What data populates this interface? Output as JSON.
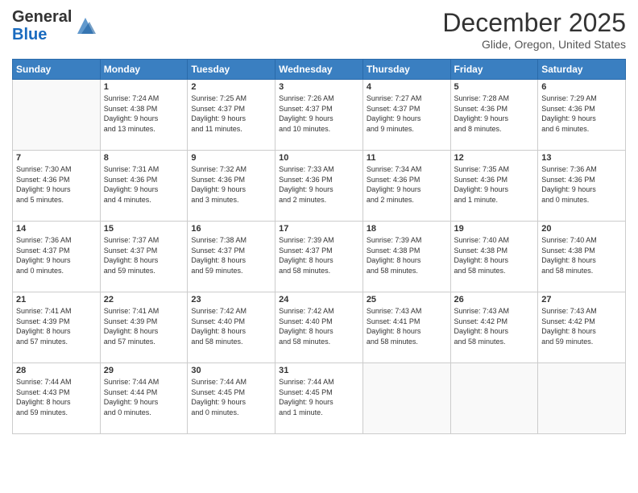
{
  "header": {
    "logo_general": "General",
    "logo_blue": "Blue",
    "month_title": "December 2025",
    "location": "Glide, Oregon, United States"
  },
  "days_of_week": [
    "Sunday",
    "Monday",
    "Tuesday",
    "Wednesday",
    "Thursday",
    "Friday",
    "Saturday"
  ],
  "weeks": [
    [
      {
        "day": "",
        "info": ""
      },
      {
        "day": "1",
        "info": "Sunrise: 7:24 AM\nSunset: 4:38 PM\nDaylight: 9 hours\nand 13 minutes."
      },
      {
        "day": "2",
        "info": "Sunrise: 7:25 AM\nSunset: 4:37 PM\nDaylight: 9 hours\nand 11 minutes."
      },
      {
        "day": "3",
        "info": "Sunrise: 7:26 AM\nSunset: 4:37 PM\nDaylight: 9 hours\nand 10 minutes."
      },
      {
        "day": "4",
        "info": "Sunrise: 7:27 AM\nSunset: 4:37 PM\nDaylight: 9 hours\nand 9 minutes."
      },
      {
        "day": "5",
        "info": "Sunrise: 7:28 AM\nSunset: 4:36 PM\nDaylight: 9 hours\nand 8 minutes."
      },
      {
        "day": "6",
        "info": "Sunrise: 7:29 AM\nSunset: 4:36 PM\nDaylight: 9 hours\nand 6 minutes."
      }
    ],
    [
      {
        "day": "7",
        "info": "Sunrise: 7:30 AM\nSunset: 4:36 PM\nDaylight: 9 hours\nand 5 minutes."
      },
      {
        "day": "8",
        "info": "Sunrise: 7:31 AM\nSunset: 4:36 PM\nDaylight: 9 hours\nand 4 minutes."
      },
      {
        "day": "9",
        "info": "Sunrise: 7:32 AM\nSunset: 4:36 PM\nDaylight: 9 hours\nand 3 minutes."
      },
      {
        "day": "10",
        "info": "Sunrise: 7:33 AM\nSunset: 4:36 PM\nDaylight: 9 hours\nand 2 minutes."
      },
      {
        "day": "11",
        "info": "Sunrise: 7:34 AM\nSunset: 4:36 PM\nDaylight: 9 hours\nand 2 minutes."
      },
      {
        "day": "12",
        "info": "Sunrise: 7:35 AM\nSunset: 4:36 PM\nDaylight: 9 hours\nand 1 minute."
      },
      {
        "day": "13",
        "info": "Sunrise: 7:36 AM\nSunset: 4:36 PM\nDaylight: 9 hours\nand 0 minutes."
      }
    ],
    [
      {
        "day": "14",
        "info": "Sunrise: 7:36 AM\nSunset: 4:37 PM\nDaylight: 9 hours\nand 0 minutes."
      },
      {
        "day": "15",
        "info": "Sunrise: 7:37 AM\nSunset: 4:37 PM\nDaylight: 8 hours\nand 59 minutes."
      },
      {
        "day": "16",
        "info": "Sunrise: 7:38 AM\nSunset: 4:37 PM\nDaylight: 8 hours\nand 59 minutes."
      },
      {
        "day": "17",
        "info": "Sunrise: 7:39 AM\nSunset: 4:37 PM\nDaylight: 8 hours\nand 58 minutes."
      },
      {
        "day": "18",
        "info": "Sunrise: 7:39 AM\nSunset: 4:38 PM\nDaylight: 8 hours\nand 58 minutes."
      },
      {
        "day": "19",
        "info": "Sunrise: 7:40 AM\nSunset: 4:38 PM\nDaylight: 8 hours\nand 58 minutes."
      },
      {
        "day": "20",
        "info": "Sunrise: 7:40 AM\nSunset: 4:38 PM\nDaylight: 8 hours\nand 58 minutes."
      }
    ],
    [
      {
        "day": "21",
        "info": "Sunrise: 7:41 AM\nSunset: 4:39 PM\nDaylight: 8 hours\nand 57 minutes."
      },
      {
        "day": "22",
        "info": "Sunrise: 7:41 AM\nSunset: 4:39 PM\nDaylight: 8 hours\nand 57 minutes."
      },
      {
        "day": "23",
        "info": "Sunrise: 7:42 AM\nSunset: 4:40 PM\nDaylight: 8 hours\nand 58 minutes."
      },
      {
        "day": "24",
        "info": "Sunrise: 7:42 AM\nSunset: 4:40 PM\nDaylight: 8 hours\nand 58 minutes."
      },
      {
        "day": "25",
        "info": "Sunrise: 7:43 AM\nSunset: 4:41 PM\nDaylight: 8 hours\nand 58 minutes."
      },
      {
        "day": "26",
        "info": "Sunrise: 7:43 AM\nSunset: 4:42 PM\nDaylight: 8 hours\nand 58 minutes."
      },
      {
        "day": "27",
        "info": "Sunrise: 7:43 AM\nSunset: 4:42 PM\nDaylight: 8 hours\nand 59 minutes."
      }
    ],
    [
      {
        "day": "28",
        "info": "Sunrise: 7:44 AM\nSunset: 4:43 PM\nDaylight: 8 hours\nand 59 minutes."
      },
      {
        "day": "29",
        "info": "Sunrise: 7:44 AM\nSunset: 4:44 PM\nDaylight: 9 hours\nand 0 minutes."
      },
      {
        "day": "30",
        "info": "Sunrise: 7:44 AM\nSunset: 4:45 PM\nDaylight: 9 hours\nand 0 minutes."
      },
      {
        "day": "31",
        "info": "Sunrise: 7:44 AM\nSunset: 4:45 PM\nDaylight: 9 hours\nand 1 minute."
      },
      {
        "day": "",
        "info": ""
      },
      {
        "day": "",
        "info": ""
      },
      {
        "day": "",
        "info": ""
      }
    ]
  ]
}
